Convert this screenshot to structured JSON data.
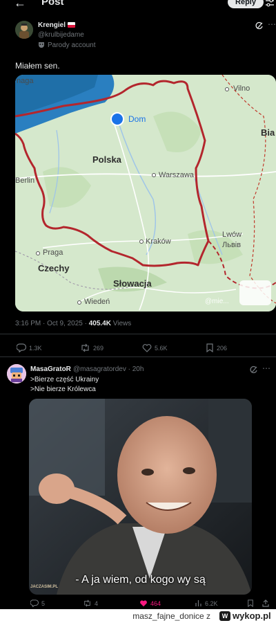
{
  "header": {
    "title": "Post",
    "reply_label": "Reply"
  },
  "post": {
    "author_name": "Krengiel",
    "author_handle": "@krulbijedame",
    "parody_label": "Parody account",
    "text": "Miałem sen.",
    "time": "3:16 PM · Oct 9, 2025 · ",
    "views_count": "405.4K",
    "views_label": " Views",
    "stats": {
      "replies": "1.3K",
      "reposts": "269",
      "likes": "5.6K",
      "bookmarks": "206"
    }
  },
  "map": {
    "labels": {
      "naga": "naga",
      "vilno": "Vilno",
      "dom": "Dom",
      "bia": "Bia",
      "polska": "Polska",
      "berlin": "Berlin",
      "warszawa": "Warszawa",
      "lwow": "Lwów",
      "lviv": "Львів",
      "krakow": "Kraków",
      "praga": "Praga",
      "czechy": "Czechy",
      "slowacja": "Słowacja",
      "wieden": "Wiedeń",
      "watermark": "@mie..."
    },
    "colors": {
      "land": "#d8ead0",
      "sea": "#1f78b4",
      "route": "#b3262d",
      "road": "#ffffff",
      "river": "#9fc5e8"
    }
  },
  "reply": {
    "author_name": "MasaGratoR",
    "author_handle": "@masagratordev",
    "time": "· 20h",
    "line1": ">Bierze część Ukrainy",
    "line2": ">Nie bierze Królewca",
    "subtitle": "- A ja wiem, od kogo wy są",
    "credit": "JACZASIM.PL",
    "stats": {
      "replies": "5",
      "reposts": "4",
      "likes": "464",
      "views": "6.2K"
    }
  },
  "footer": {
    "text": "masz_fajne_donice z",
    "logo_mark": "W",
    "logo_text": "wykop.pl"
  }
}
